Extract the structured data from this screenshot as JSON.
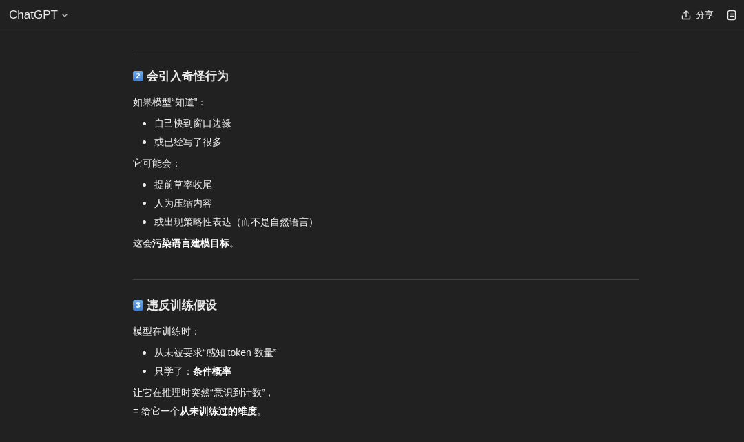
{
  "header": {
    "title": "ChatGPT",
    "share_label": "分享"
  },
  "sections": [
    {
      "number": "2",
      "title": "会引入奇怪行为",
      "blocks": [
        {
          "kind": "p",
          "text": "如果模型“知道”："
        },
        {
          "kind": "ul",
          "items": [
            "自己快到窗口边缘",
            "或已经写了很多"
          ]
        },
        {
          "kind": "p",
          "text": "它可能会："
        },
        {
          "kind": "ul",
          "items": [
            "提前草率收尾",
            "人为压缩内容",
            "或出现策略性表达（而不是自然语言）"
          ]
        },
        {
          "kind": "p",
          "text": "这会**污染语言建模目标**。"
        }
      ]
    },
    {
      "number": "3",
      "title": "违反训练假设",
      "blocks": [
        {
          "kind": "p",
          "text": "模型在训练时："
        },
        {
          "kind": "ul",
          "items": [
            "从未被要求“感知 token 数量”",
            "只学了：**条件概率**"
          ]
        },
        {
          "kind": "lines",
          "lines": [
            "让它在推理时突然“意识到计数”，",
            "= 给它一个**从未训练过的维度**。"
          ]
        }
      ]
    }
  ]
}
